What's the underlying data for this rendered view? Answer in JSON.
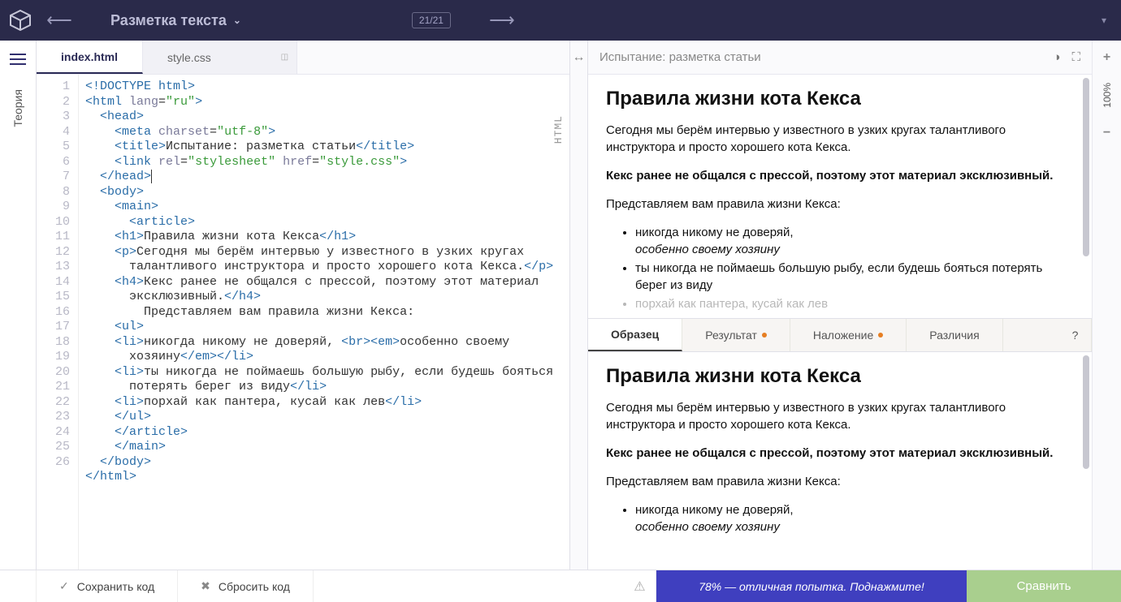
{
  "topbar": {
    "title": "Разметка текста",
    "counter": "21/21"
  },
  "sidebar": {
    "theory": "Теория"
  },
  "tabs": [
    {
      "label": "index.html",
      "active": true
    },
    {
      "label": "style.css",
      "active": false
    }
  ],
  "vlabel": "HTML",
  "code_lines": 26,
  "code": {
    "l1": "<!DOCTYPE html>",
    "l2_open": "<html ",
    "l2_attr": "lang",
    "l2_val": "\"ru\"",
    "l2_close": ">",
    "l3": "<head>",
    "l4_open": "<meta ",
    "l4_a1": "charset",
    "l4_v1": "\"utf-8\"",
    "l4_close": ">",
    "l5_open": "<title>",
    "l5_txt": "Испытание: разметка статьи",
    "l5_close": "</title>",
    "l6_open": "<link ",
    "l6_a1": "rel",
    "l6_v1": "\"stylesheet\"",
    "l6_a2": "href",
    "l6_v2": "\"style.css\"",
    "l6_close": ">",
    "l7": "</head>",
    "l8": "<body>",
    "l9": "<main>",
    "l10": "<article>",
    "l11_open": "<h1>",
    "l11_txt": "Правила жизни кота Кекса",
    "l11_close": "</h1>",
    "l12_open": "<p>",
    "l12_txt1": "Сегодня мы берём интервью у известного в узких кругах",
    "l12_txt2": "талантливого инструктора и просто хорошего кота Кекса.",
    "l12_close": "</p>",
    "l13_open": "<h4>",
    "l13_txt1": "Кекс ранее не общался с прессой, поэтому этот материал",
    "l13_txt2": "эксклюзивный.",
    "l13_close": "</h4>",
    "l14_txt": "Представляем вам правила жизни Кекса:",
    "l15": "<ul>",
    "l16_open": "<li>",
    "l16_txt1": "никогда никому не доверяй, ",
    "l16_br": "<br>",
    "l16_emopen": "<em>",
    "l16_txt2": "особенно своему",
    "l16_txt3": "хозяину",
    "l16_emclose": "</em>",
    "l16_close": "</li>",
    "l17_open": "<li>",
    "l17_txt1": "ты никогда не поймаешь большую рыбу, если будешь бояться",
    "l17_txt2": "потерять берег из виду",
    "l17_close": "</li>",
    "l18_open": "<li>",
    "l18_txt": "порхай как пантера, кусай как лев",
    "l18_close": "</li>",
    "l19": "</ul>",
    "l20": "</article>",
    "l21": "</main>",
    "l22": "</body>",
    "l23": "</html>"
  },
  "preview": {
    "header_title": "Испытание: разметка статьи",
    "h1": "Правила жизни кота Кекса",
    "p1": "Сегодня мы берём интервью у известного в узких кругах талантливого инструктора и просто хорошего кота Кекса.",
    "p2": "Кекс ранее не общался с прессой, поэтому этот материал эксклюзивный.",
    "p3": "Представляем вам правила жизни Кекса:",
    "li1a": "никогда никому не доверяй,",
    "li1b": "особенно своему хозяину",
    "li2": "ты никогда не поймаешь большую рыбу, если будешь бояться потерять берег из виду",
    "li3": "порхай как пантера, кусай как лев"
  },
  "preview_tabs": {
    "t1": "Образец",
    "t2": "Результат",
    "t3": "Наложение",
    "t4": "Различия",
    "q": "?"
  },
  "right": {
    "zoom": "100%"
  },
  "bottom": {
    "save": "Сохранить код",
    "reset": "Сбросить код",
    "progress": "78% — отличная попытка. Поднажмите!",
    "compare": "Сравнить"
  }
}
